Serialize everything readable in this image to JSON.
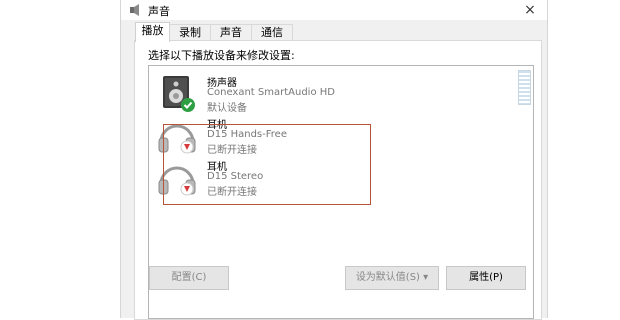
{
  "dialog": {
    "title": "声音",
    "close_label": "×"
  },
  "tabs": [
    {
      "label": "播放",
      "active": true
    },
    {
      "label": "录制",
      "active": false
    },
    {
      "label": "声音",
      "active": false
    },
    {
      "label": "通信",
      "active": false
    }
  ],
  "panel": {
    "instruction": "选择以下播放设备来修改设置:"
  },
  "devices": [
    {
      "name": "扬声器",
      "description": "Conexant SmartAudio HD",
      "status": "默认设备",
      "icon": "speaker-icon",
      "status_badge": "default-check"
    },
    {
      "name": "耳机",
      "description": "D15 Hands-Free",
      "status": "已断开连接",
      "icon": "headphones-icon",
      "status_badge": "disconnected"
    },
    {
      "name": "耳机",
      "description": "D15 Stereo",
      "status": "已断开连接",
      "icon": "headphones-icon",
      "status_badge": "disconnected"
    }
  ],
  "buttons": {
    "configure": "配置(C)",
    "set_default": "设为默认值(S) ▾",
    "properties": "属性(P)"
  },
  "colors": {
    "highlight_border": "#b4553a",
    "check_green": "#2ea043",
    "disconnect_red": "#d73a3a"
  }
}
